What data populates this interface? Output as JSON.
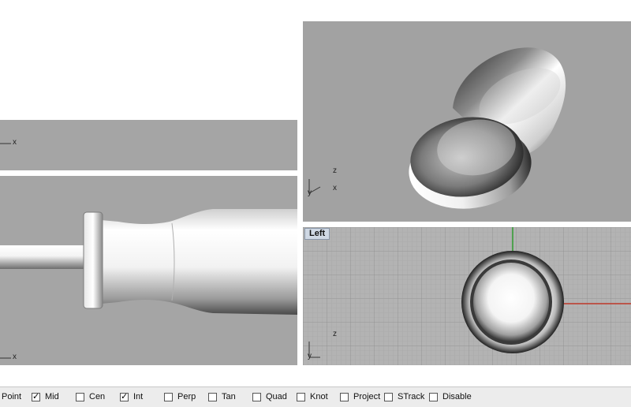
{
  "viewports": {
    "left_label": "Left",
    "axis": {
      "x": "x",
      "y": "y",
      "z": "z"
    }
  },
  "osnap": {
    "items": [
      {
        "label": "Point",
        "checked": null
      },
      {
        "label": "Mid",
        "checked": true
      },
      {
        "label": "Cen",
        "checked": false
      },
      {
        "label": "Int",
        "checked": true
      },
      {
        "label": "Perp",
        "checked": false
      },
      {
        "label": "Tan",
        "checked": false
      },
      {
        "label": "Quad",
        "checked": false
      },
      {
        "label": "Knot",
        "checked": false
      },
      {
        "label": "Project",
        "checked": false
      },
      {
        "label": "STrack",
        "checked": false
      },
      {
        "label": "Disable",
        "checked": false
      }
    ]
  },
  "colors": {
    "viewport_bg": "#a5a5a5",
    "grid_line": "#9f9f9f",
    "x_axis": "#c0392b",
    "y_axis": "#2e9b2e",
    "active_label_bg": "#cfd8e4"
  }
}
